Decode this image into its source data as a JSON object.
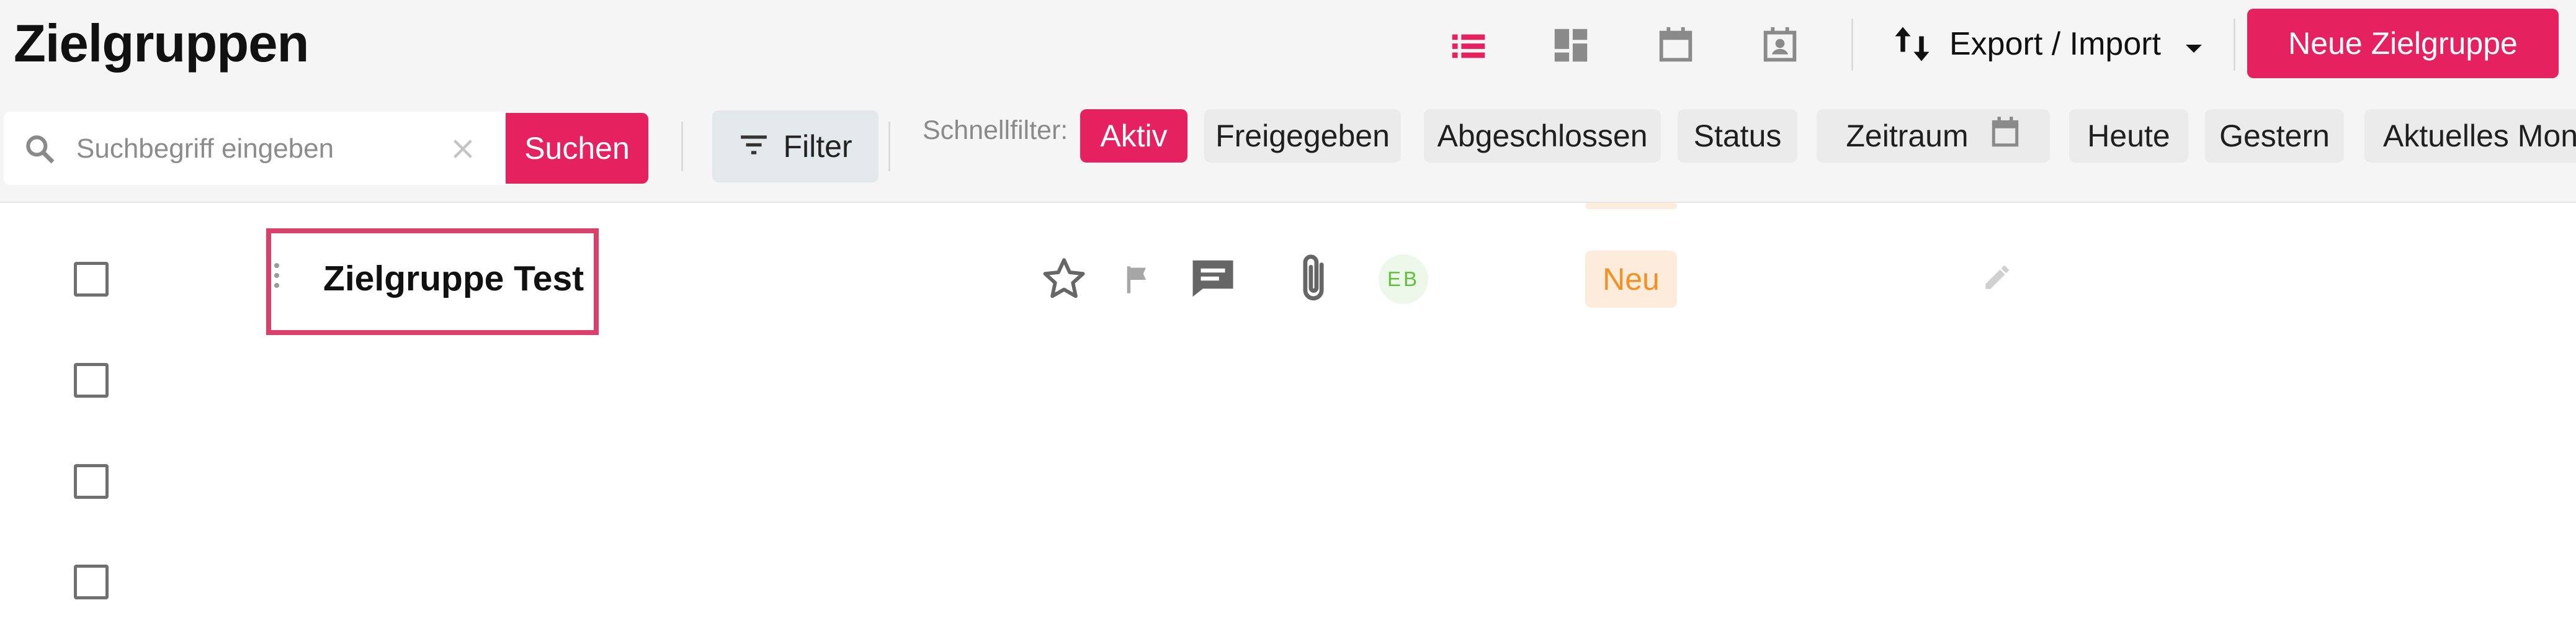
{
  "page": {
    "title": "Zielgruppen"
  },
  "header": {
    "views": [
      {
        "icon": "list-view-icon",
        "active": true
      },
      {
        "icon": "dashboard-view-icon",
        "active": false
      },
      {
        "icon": "calendar-view-icon",
        "active": false
      },
      {
        "icon": "contact-calendar-view-icon",
        "active": false
      }
    ],
    "export_label": "Export / Import",
    "new_button_label": "Neue Zielgruppe"
  },
  "toolbar": {
    "search_placeholder": "Suchbegriff eingeben",
    "search_value": "",
    "search_button_label": "Suchen",
    "filter_button_label": "Filter",
    "quickfilter_label": "Schnellfilter:",
    "chips": [
      {
        "label": "Aktiv",
        "active": true
      },
      {
        "label": "Freigegeben",
        "active": false
      },
      {
        "label": "Abgeschlossen",
        "active": false
      },
      {
        "label": "Status",
        "active": false
      },
      {
        "label": "Zeitraum",
        "active": false,
        "icon": "calendar-icon"
      },
      {
        "label": "Heute",
        "active": false
      },
      {
        "label": "Gestern",
        "active": false
      },
      {
        "label": "Aktuelles Mon",
        "active": false
      }
    ]
  },
  "table": {
    "rows": [
      {
        "name": "Zielgruppe Test",
        "owner_initials": "EB",
        "status": "Neu",
        "icons": [
          "star-icon",
          "flag-icon",
          "comment-icon",
          "attachment-icon",
          "edit-icon"
        ]
      }
    ]
  },
  "colors": {
    "accent": "#e6215f",
    "status_new_bg": "#fdebdc",
    "status_new_text": "#f19126",
    "avatar_text": "#5ec23c",
    "highlight_border": "#dc3f6a"
  }
}
